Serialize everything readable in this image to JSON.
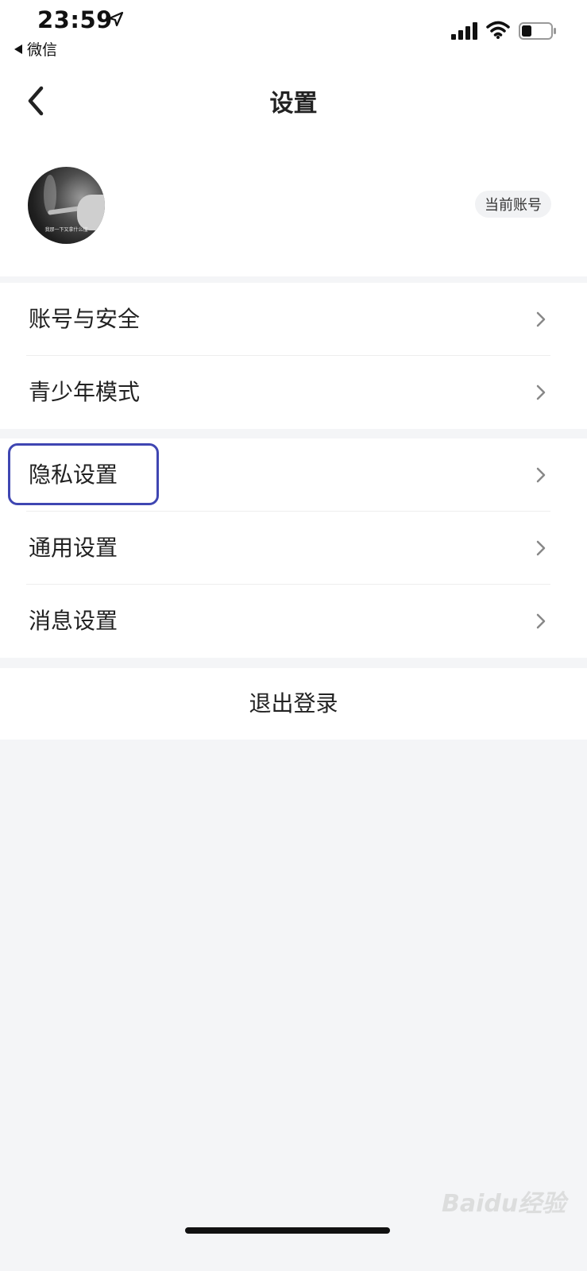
{
  "status_bar": {
    "time": "23:59",
    "back_app": "微信"
  },
  "nav": {
    "title": "设置"
  },
  "profile": {
    "badge": "当前账号",
    "avatar_caption": "我那一下又拿什么懂"
  },
  "groups": [
    {
      "items": [
        {
          "label": "账号与安全"
        },
        {
          "label": "青少年模式"
        }
      ]
    },
    {
      "items": [
        {
          "label": "隐私设置"
        },
        {
          "label": "通用设置"
        },
        {
          "label": "消息设置"
        }
      ]
    }
  ],
  "logout": {
    "label": "退出登录"
  },
  "watermark": "Baidu经验",
  "colors": {
    "highlight": "#3f46b2",
    "background": "#f4f5f7"
  }
}
